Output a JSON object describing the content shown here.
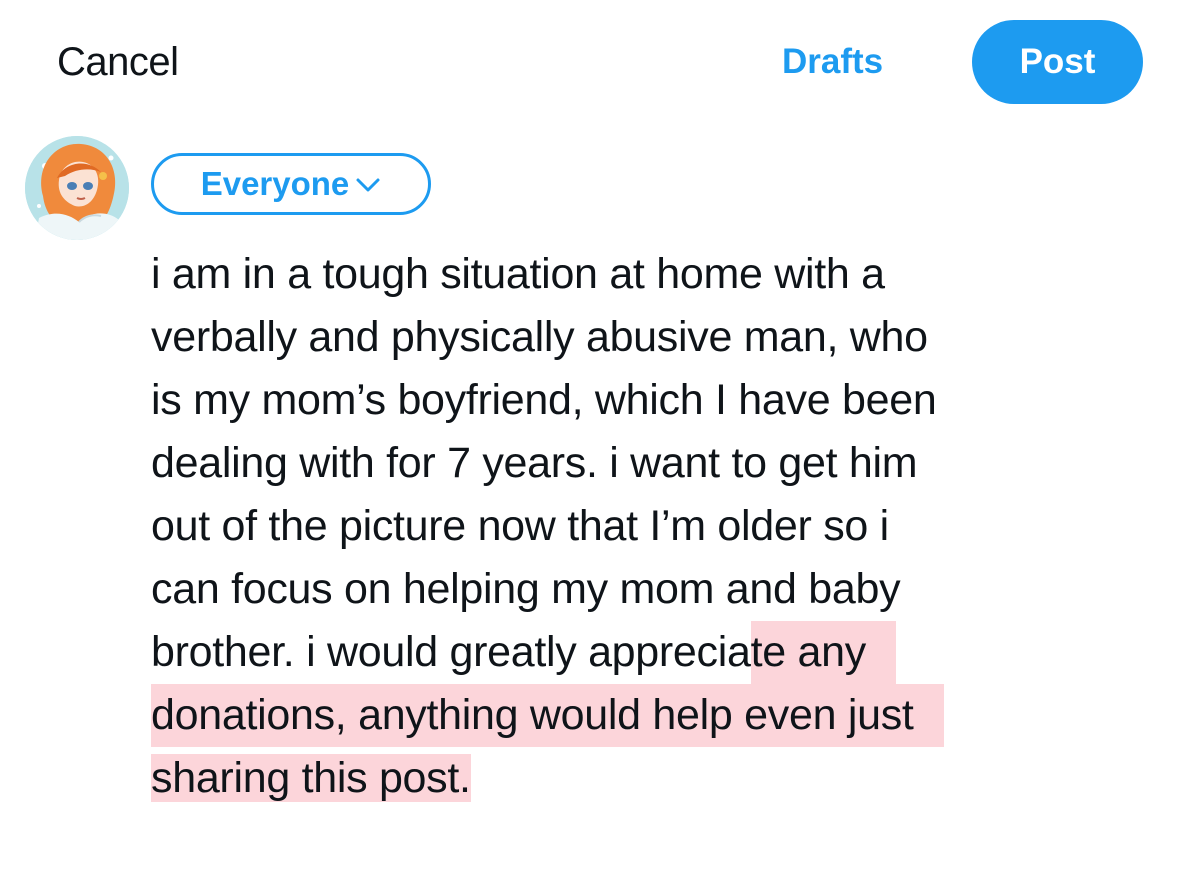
{
  "header": {
    "cancel_label": "Cancel",
    "drafts_label": "Drafts",
    "post_label": "Post"
  },
  "audience": {
    "label": "Everyone",
    "icon": "chevron-down-icon"
  },
  "composer": {
    "lines": [
      "i am in a tough situation at home with a",
      "verbally and physically abusive man, who",
      "is my mom’s boyfriend, which I have been",
      "dealing with for 7 years. i want to get him",
      "out of the picture now that I’m older so i",
      "can focus on helping my mom and baby"
    ],
    "line7_plain": "brother. i would greatly apprecia",
    "line7_highlight": "te any",
    "line8_highlight": "donations, anything would help even just",
    "line9_highlight": "sharing this post."
  },
  "colors": {
    "accent": "#1d9bf0",
    "text": "#0f1419",
    "highlight": "#fcd5da"
  }
}
